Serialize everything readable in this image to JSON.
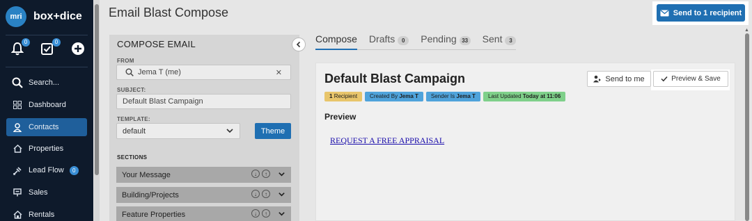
{
  "brand": {
    "logo_text": "mri",
    "name": "box+dice"
  },
  "quick_actions": {
    "notifications_count": "0",
    "tasks_count": "0"
  },
  "nav": {
    "items": [
      {
        "label": "Search...",
        "icon": "search-icon"
      },
      {
        "label": "Dashboard",
        "icon": "dashboard-icon"
      },
      {
        "label": "Contacts",
        "icon": "contacts-icon",
        "active": true
      },
      {
        "label": "Properties",
        "icon": "properties-icon"
      },
      {
        "label": "Lead Flow",
        "icon": "lead-flow-icon",
        "count": "0"
      },
      {
        "label": "Sales",
        "icon": "sales-icon"
      },
      {
        "label": "Rentals",
        "icon": "rentals-icon"
      }
    ]
  },
  "header": {
    "title": "Email Blast Compose",
    "send_button": "Send to 1 recipient"
  },
  "compose": {
    "panel_title": "COMPOSE EMAIL",
    "from_label": "FROM",
    "from_value": "Jema T (me)",
    "subject_label": "SUBJECT:",
    "subject_value": "Default Blast Campaign",
    "template_label": "TEMPLATE:",
    "template_value": "default",
    "theme_button": "Theme",
    "sections_label": "SECTIONS",
    "sections": [
      "Your Message",
      "Building/Projects",
      "Feature Properties"
    ]
  },
  "tabs": [
    {
      "label": "Compose",
      "active": true
    },
    {
      "label": "Drafts",
      "count": "0"
    },
    {
      "label": "Pending",
      "count": "33"
    },
    {
      "label": "Sent",
      "count": "3"
    }
  ],
  "campaign": {
    "title": "Default Blast Campaign",
    "send_to_me": "Send to me",
    "preview_save": "Preview & Save",
    "tags": {
      "recipients_count": "1",
      "recipients_label": "Recipient",
      "created_prefix": "Created By",
      "created_by": "Jema T",
      "sender_prefix": "Sender Is",
      "sender": "Jema T",
      "updated_prefix": "Last Updated",
      "updated": "Today at 11:06"
    },
    "preview_label": "Preview",
    "link_text": "REQUEST A FREE APPRAISAL"
  },
  "colors": {
    "nav_bg": "#0e1a2b",
    "primary": "#1f6fb2",
    "tag_yellow": "#e8c56b",
    "tag_blue": "#4fa3db",
    "tag_green": "#7fd08a"
  }
}
